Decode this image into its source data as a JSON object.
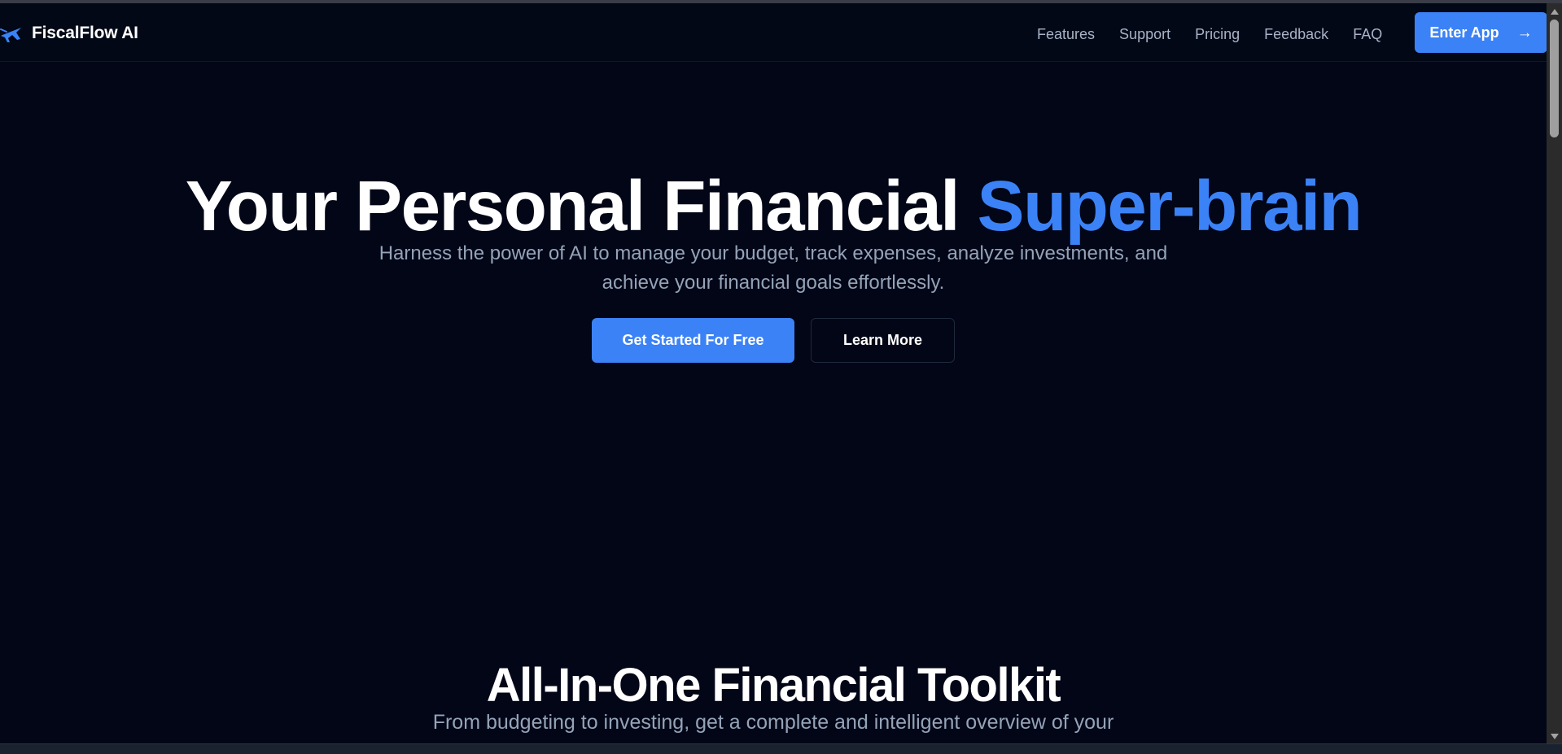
{
  "brand": {
    "name": "FiscalFlow AI",
    "icon": "plane-icon",
    "accent_color": "#3b82f6"
  },
  "nav": {
    "links": [
      {
        "label": "Features"
      },
      {
        "label": "Support"
      },
      {
        "label": "Pricing"
      },
      {
        "label": "Feedback"
      },
      {
        "label": "FAQ"
      }
    ],
    "cta_label": "Enter App",
    "cta_icon": "arrow-right-icon"
  },
  "hero": {
    "title_main": "Your Personal Financial ",
    "title_accent": "Super-brain",
    "subtitle": "Harness the power of AI to manage your budget, track expenses, analyze investments, and achieve your financial goals effortlessly.",
    "primary_cta": "Get Started For Free",
    "secondary_cta": "Learn More"
  },
  "toolkit": {
    "title": "All-In-One Financial Toolkit",
    "subtitle": "From budgeting to investing, get a complete and intelligent overview of your financial life."
  },
  "colors": {
    "background": "#020617",
    "primary": "#3b82f6",
    "muted_text": "#94a3b8"
  }
}
